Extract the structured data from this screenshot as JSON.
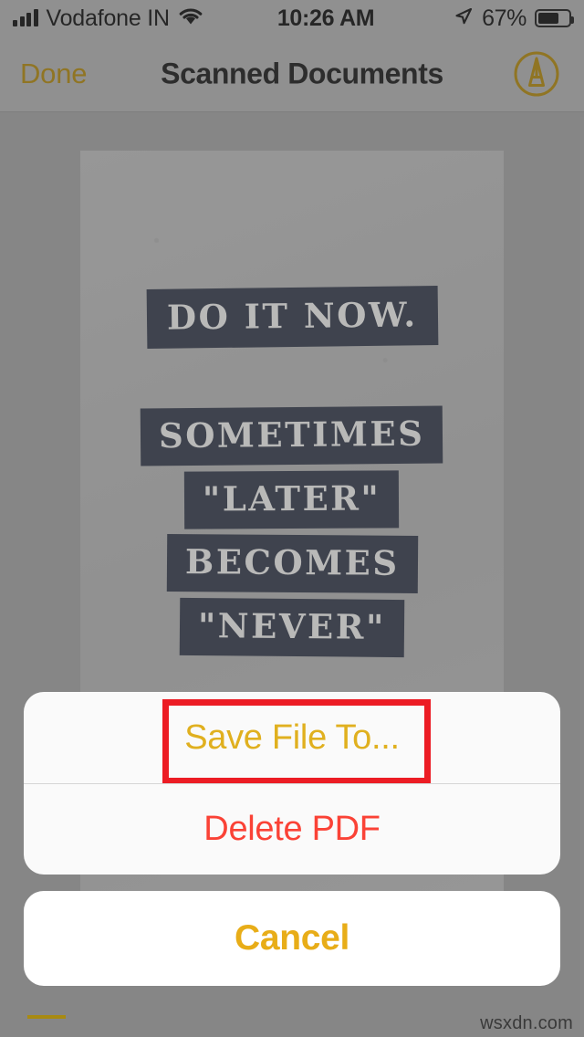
{
  "status_bar": {
    "carrier": "Vodafone IN",
    "time": "10:26 AM",
    "battery_percent": "67%",
    "signal_icon": "signal-bars-icon",
    "wifi_icon": "wifi-icon",
    "location_icon": "location-arrow-icon",
    "battery_icon": "battery-icon"
  },
  "nav_bar": {
    "done_label": "Done",
    "title": "Scanned Documents",
    "markup_icon": "markup-pen-circle-icon"
  },
  "document": {
    "poster_lines": [
      "DO IT NOW.",
      "SOMETIMES",
      "\"LATER\"",
      "BECOMES",
      "\"NEVER\""
    ]
  },
  "action_sheet": {
    "primary_items": [
      {
        "id": "save",
        "label": "Save File To...",
        "color": "#e0b01f",
        "highlighted": true
      },
      {
        "id": "delete",
        "label": "Delete PDF",
        "color": "#fa4236",
        "highlighted": false
      }
    ],
    "cancel_label": "Cancel",
    "cancel_color": "#e8ad18",
    "annotation_color": "#ec1c24"
  },
  "watermark": "wsxdn.com",
  "colors": {
    "accent_gold": "#e8ad18",
    "destructive_red": "#fa4236",
    "annotation_red": "#ec1c24",
    "nav_bar_bg": "#a8a8a8",
    "dim_bg": "#9a9a9a",
    "sheet_bg": "#fafafa",
    "poster_bar": "#343a4a"
  }
}
